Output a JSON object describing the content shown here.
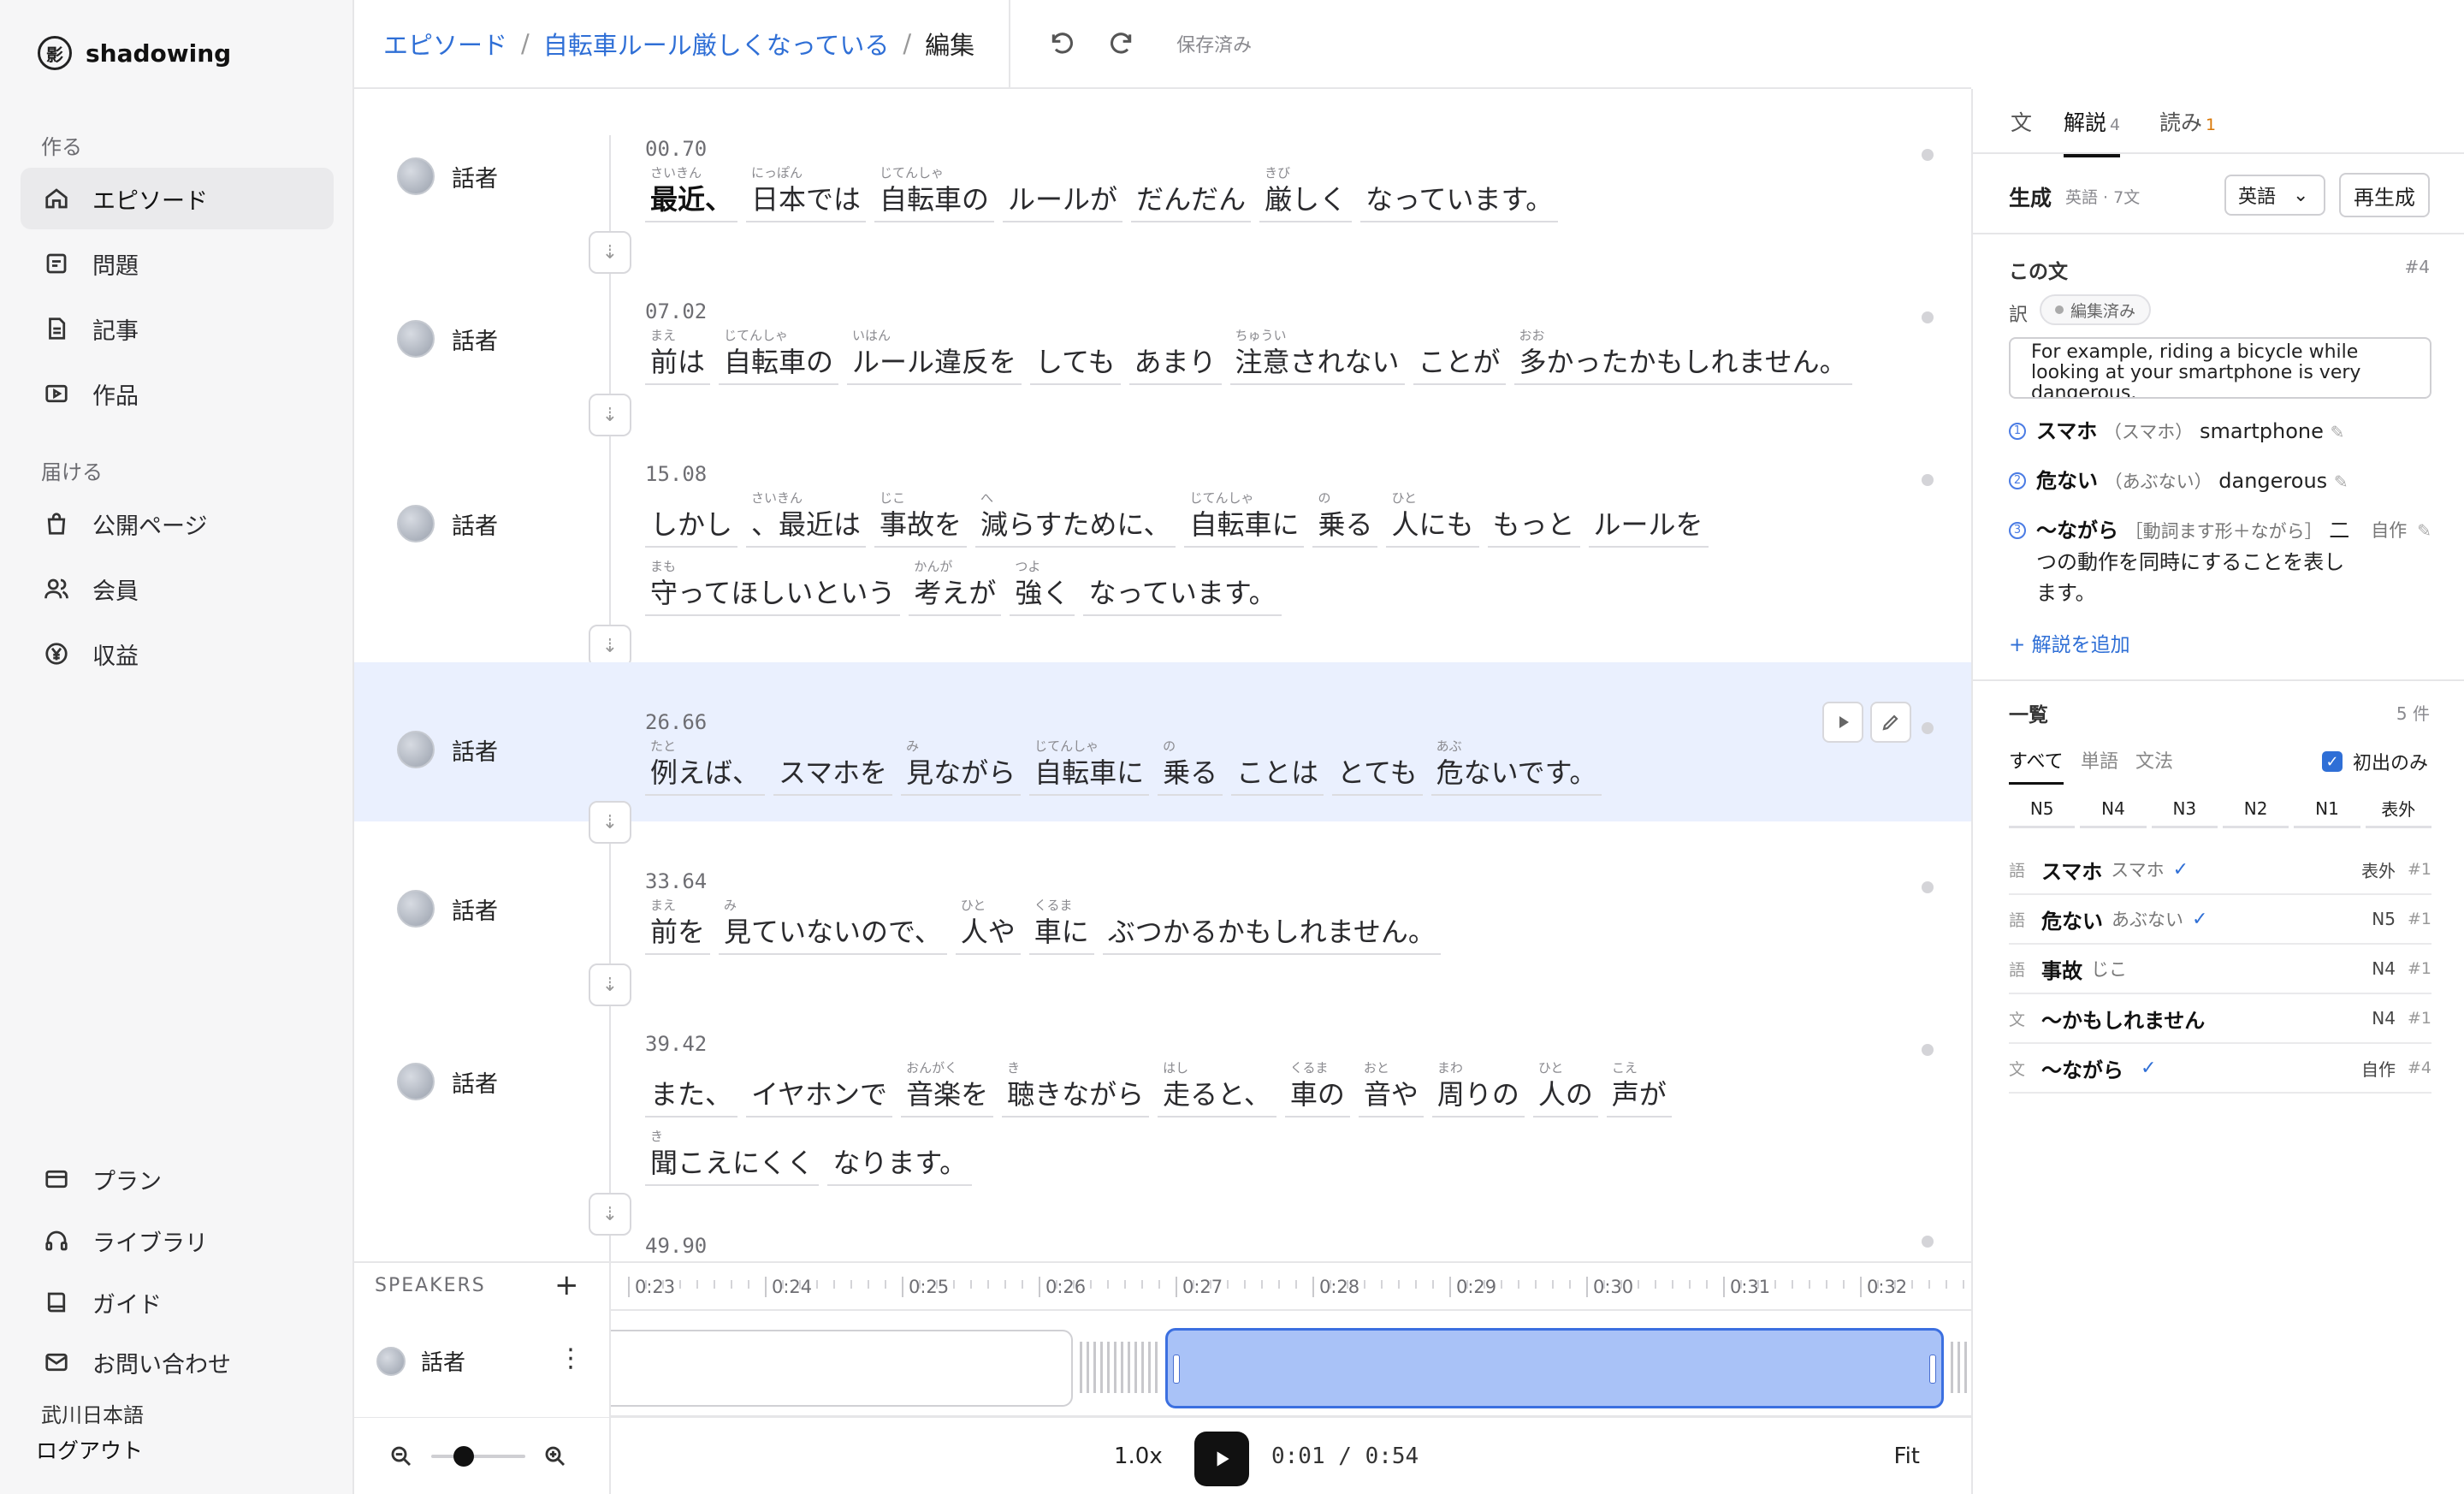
{
  "brand": {
    "logo": "影",
    "name": "shadowing"
  },
  "sidebar": {
    "sections": [
      {
        "heading": "作る",
        "items": [
          {
            "label": "エピソード",
            "icon": "home-icon"
          },
          {
            "label": "問題",
            "icon": "quiz-icon"
          },
          {
            "label": "記事",
            "icon": "document-icon"
          },
          {
            "label": "作品",
            "icon": "video-icon"
          }
        ]
      },
      {
        "heading": "届ける",
        "items": [
          {
            "label": "公開ページ",
            "icon": "shopping-bag-icon"
          },
          {
            "label": "会員",
            "icon": "users-icon"
          },
          {
            "label": "収益",
            "icon": "yen-icon"
          }
        ]
      }
    ],
    "bottom": [
      {
        "label": "プラン",
        "icon": "credit-card-icon"
      },
      {
        "label": "ライブラリ",
        "icon": "headphones-icon"
      },
      {
        "label": "ガイド",
        "icon": "book-icon"
      },
      {
        "label": "お問い合わせ",
        "icon": "mail-icon"
      }
    ],
    "org": "武川日本語",
    "logout": "ログアウト"
  },
  "topbar": {
    "crumbs": [
      "エピソード",
      "自転車ルール厳しくなっている",
      "編集"
    ],
    "separator": "/",
    "saved": "保存済み"
  },
  "sentences": [
    {
      "speaker": "話者",
      "time": "00.70",
      "lines": [
        [
          {
            "r": "さいきん",
            "t": "最近、",
            "strong": true
          },
          {
            "r": "にっぽん",
            "t": "日本では"
          },
          {
            "r": "じてんしゃ",
            "t": "自転車の"
          },
          {
            "r": "",
            "t": "ルールが"
          },
          {
            "r": "",
            "t": "だんだん"
          },
          {
            "r": "きび",
            "t": "厳しく"
          },
          {
            "r": "",
            "t": "なっています。"
          }
        ]
      ]
    },
    {
      "speaker": "話者",
      "time": "07.02",
      "lines": [
        [
          {
            "r": "まえ",
            "t": "前は"
          },
          {
            "r": "じてんしゃ",
            "t": "自転車の"
          },
          {
            "r": "いはん",
            "t": "ルール違反を"
          },
          {
            "r": "",
            "t": "しても"
          },
          {
            "r": "",
            "t": "あまり"
          },
          {
            "r": "ちゅうい",
            "t": "注意されない"
          },
          {
            "r": "",
            "t": "ことが"
          },
          {
            "r": "おお",
            "t": "多かったかもしれません。"
          }
        ]
      ]
    },
    {
      "speaker": "話者",
      "time": "15.08",
      "lines": [
        [
          {
            "r": "",
            "t": "しかし"
          },
          {
            "r": "さいきん",
            "t": "、最近は"
          },
          {
            "r": "じこ",
            "t": "事故を"
          },
          {
            "r": "へ",
            "t": "減らすために、"
          },
          {
            "r": "じてんしゃ",
            "t": "自転車に"
          },
          {
            "r": "の",
            "t": "乗る"
          },
          {
            "r": "ひと",
            "t": "人にも"
          },
          {
            "r": "",
            "t": "もっと"
          },
          {
            "r": "",
            "t": "ルールを"
          }
        ],
        [
          {
            "r": "まも",
            "t": "守ってほしいという"
          },
          {
            "r": "かんが",
            "t": "考えが"
          },
          {
            "r": "つよ",
            "t": "強く"
          },
          {
            "r": "",
            "t": "なっています。"
          }
        ]
      ]
    },
    {
      "speaker": "話者",
      "time": "26.66",
      "selected": true,
      "lines": [
        [
          {
            "r": "たと",
            "t": "例えば、"
          },
          {
            "r": "",
            "t": "スマホを"
          },
          {
            "r": "み",
            "t": "見ながら"
          },
          {
            "r": "じてんしゃ",
            "t": "自転車に"
          },
          {
            "r": "の",
            "t": "乗る"
          },
          {
            "r": "",
            "t": "ことは"
          },
          {
            "r": "",
            "t": "とても"
          },
          {
            "r": "あぶ",
            "t": "危ないです。"
          }
        ]
      ]
    },
    {
      "speaker": "話者",
      "time": "33.64",
      "lines": [
        [
          {
            "r": "まえ",
            "t": "前を"
          },
          {
            "r": "み",
            "t": "見ていないので、"
          },
          {
            "r": "ひと",
            "t": "人や"
          },
          {
            "r": "くるま",
            "t": "車に"
          },
          {
            "r": "",
            "t": "ぶつかるかもしれません。"
          }
        ]
      ]
    },
    {
      "speaker": "話者",
      "time": "39.42",
      "lines": [
        [
          {
            "r": "",
            "t": "また、"
          },
          {
            "r": "",
            "t": "イヤホンで"
          },
          {
            "r": "おんがく",
            "t": "音楽を"
          },
          {
            "r": "き",
            "t": "聴きながら"
          },
          {
            "r": "はし",
            "t": "走ると、"
          },
          {
            "r": "くるま",
            "t": "車の"
          },
          {
            "r": "おと",
            "t": "音や"
          },
          {
            "r": "まわ",
            "t": "周りの"
          },
          {
            "r": "ひと",
            "t": "人の"
          },
          {
            "r": "こえ",
            "t": "声が"
          }
        ],
        [
          {
            "r": "き",
            "t": "聞こえにくく"
          },
          {
            "r": "",
            "t": "なります。"
          }
        ]
      ]
    },
    {
      "speaker": "",
      "time": "49.90",
      "lines": []
    }
  ],
  "timeline": {
    "speakers_heading": "SPEAKERS",
    "speaker": "話者",
    "ticks": [
      "0:23",
      "0:24",
      "0:25",
      "0:26",
      "0:27",
      "0:28",
      "0:29",
      "0:30",
      "0:31",
      "0:32"
    ],
    "rate": "1.0x",
    "current": "0:01",
    "duration": "0:54",
    "time_sep": "/",
    "fit": "Fit",
    "zoom_level": 0.3
  },
  "panel": {
    "tabs": [
      {
        "label": "文",
        "count": ""
      },
      {
        "label": "解説",
        "count": "4"
      },
      {
        "label": "読み",
        "count": "1"
      }
    ],
    "generate": {
      "label": "生成",
      "sub": "英語 · 7文",
      "language": "英語",
      "button": "再生成"
    },
    "this_sentence": {
      "title": "この文",
      "index": "#4"
    },
    "translation": {
      "label": "訳",
      "badge": "編集済み",
      "text": "For example, riding a bicycle while looking at your smartphone is very dangerous."
    },
    "explanations": [
      {
        "num": "1",
        "word": "スマホ",
        "reading": "（スマホ）",
        "gloss": "smartphone",
        "extra": ""
      },
      {
        "num": "2",
        "word": "危ない",
        "reading": "（あぶない）",
        "gloss": "dangerous",
        "extra": ""
      },
      {
        "num": "3",
        "word": "〜ながら",
        "reading": "［動詞ます形＋ながら］",
        "gloss": "二つの動作を同時にすることを表します。",
        "extra": "自作"
      }
    ],
    "add_explanation": "+ 解説を追加",
    "list": {
      "title": "一覧",
      "count": "5 件",
      "filters": [
        "すべて",
        "単語",
        "文法"
      ],
      "first_only": "初出のみ",
      "first_only_checked": true,
      "levels": [
        "N5",
        "N4",
        "N3",
        "N2",
        "N1",
        "表外"
      ],
      "items": [
        {
          "kind": "語",
          "word": "スマホ",
          "reading": "スマホ",
          "checked": true,
          "level": "表外",
          "ref": "#1"
        },
        {
          "kind": "語",
          "word": "危ない",
          "reading": "あぶない",
          "checked": true,
          "level": "N5",
          "ref": "#1"
        },
        {
          "kind": "語",
          "word": "事故",
          "reading": "じこ",
          "checked": false,
          "level": "N4",
          "ref": "#1"
        },
        {
          "kind": "文",
          "word": "〜かもしれません",
          "reading": "",
          "checked": false,
          "level": "N4",
          "ref": "#1"
        },
        {
          "kind": "文",
          "word": "〜ながら",
          "reading": "",
          "checked": true,
          "level": "自作",
          "ref": "#4"
        }
      ]
    }
  }
}
